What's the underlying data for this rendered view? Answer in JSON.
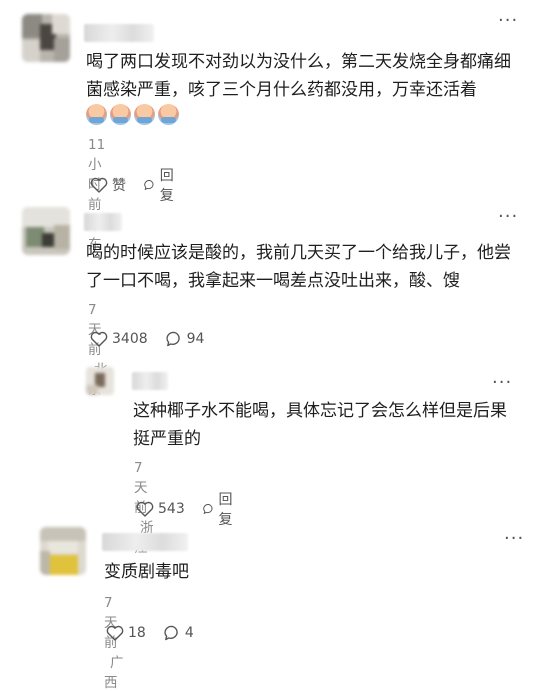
{
  "comments": [
    {
      "text": "喝了两口发现不对劲以为没什么，第二天发烧全身都痛细菌感染严重，咳了三个月什么药都没用，万幸还活着",
      "emoji_count": 4,
      "time": "11小时前",
      "location": "广东",
      "like_label": "赞",
      "reply_label": "回复",
      "more": "···"
    },
    {
      "text": "喝的时候应该是酸的，我前几天买了一个给我儿子，他尝了一口不喝，我拿起来一喝差点没吐出来，酸、馊",
      "time": "7天前",
      "location": "北京",
      "like_label": "3408",
      "reply_label": "94",
      "more": "···"
    },
    {
      "text": "这种椰子水不能喝，具体忘记了会怎么样但是后果挺严重的",
      "time": "7天前",
      "location": "浙江",
      "like_label": "543",
      "reply_label": "回复",
      "more": "···"
    },
    {
      "text": "变质剧毒吧",
      "time": "7天前",
      "location": "广西",
      "like_label": "18",
      "reply_label": "4",
      "more": "···"
    }
  ]
}
